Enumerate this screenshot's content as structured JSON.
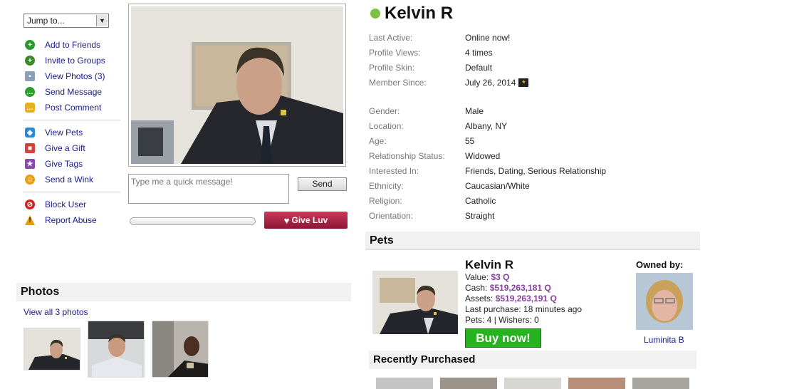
{
  "jump": {
    "label": "Jump to..."
  },
  "actions": [
    {
      "label": "Add to Friends",
      "icon": "plus-circle-icon",
      "color": "#2a9a2a",
      "glyph": "+"
    },
    {
      "label": "Invite to Groups",
      "icon": "group-plus-icon",
      "color": "#3a8a2a",
      "glyph": "+"
    },
    {
      "label": "View Photos (3)",
      "icon": "camera-icon",
      "color": "#8aa0b8",
      "glyph": "▪"
    },
    {
      "label": "Send Message",
      "icon": "speech-bubble-icon",
      "color": "#2aa02a",
      "glyph": "…"
    },
    {
      "label": "Post Comment",
      "icon": "comment-icon",
      "color": "#e8b020",
      "glyph": "…"
    },
    {
      "label": "View Pets",
      "icon": "tag-icon",
      "color": "#2a8ad8",
      "glyph": "◆"
    },
    {
      "label": "Give a Gift",
      "icon": "gift-icon",
      "color": "#d84040",
      "glyph": "■"
    },
    {
      "label": "Give Tags",
      "icon": "star-icon",
      "color": "#8a4ab0",
      "glyph": "★"
    },
    {
      "label": "Send a Wink",
      "icon": "smiley-icon",
      "color": "#e8a010",
      "glyph": "☺"
    },
    {
      "label": "Block User",
      "icon": "block-icon",
      "color": "#d02020",
      "glyph": "⊘"
    },
    {
      "label": "Report Abuse",
      "icon": "warning-icon",
      "color": "#e8a000",
      "glyph": "!"
    }
  ],
  "quick_message": {
    "placeholder": "Type me a quick message!",
    "send_label": "Send"
  },
  "give_luv_label": "Give Luv",
  "photos": {
    "title": "Photos",
    "view_all": "View all 3 photos"
  },
  "profile": {
    "name": "Kelvin R",
    "status_color": "#7ec142",
    "fields_a": [
      {
        "k": "Last Active:",
        "v": "Online now!"
      },
      {
        "k": "Profile Views:",
        "v": "4 times"
      },
      {
        "k": "Profile Skin:",
        "v": "Default"
      },
      {
        "k": "Member Since:",
        "v": "July 26, 2014"
      }
    ],
    "fields_b": [
      {
        "k": "Gender:",
        "v": "Male"
      },
      {
        "k": "Location:",
        "v": "Albany, NY"
      },
      {
        "k": "Age:",
        "v": "55"
      },
      {
        "k": "Relationship Status:",
        "v": "Widowed"
      },
      {
        "k": "Interested In:",
        "v": "Friends, Dating, Serious Relationship"
      },
      {
        "k": "Ethnicity:",
        "v": "Caucasian/White"
      },
      {
        "k": "Religion:",
        "v": "Catholic"
      },
      {
        "k": "Orientation:",
        "v": "Straight"
      }
    ]
  },
  "pets": {
    "title": "Pets",
    "name": "Kelvin R",
    "value_label": "Value:",
    "value": "$3 Q",
    "cash_label": "Cash:",
    "cash": "$519,263,181 Q",
    "assets_label": "Assets:",
    "assets": "$519,263,191 Q",
    "last_purchase": "Last purchase: 18 minutes ago",
    "pets_wishers": "Pets: 4 | Wishers: 0",
    "buy_label": "Buy now!",
    "owned_by": "Owned by:",
    "owner_name": "Luminita B",
    "recently_purchased": "Recently Purchased"
  }
}
